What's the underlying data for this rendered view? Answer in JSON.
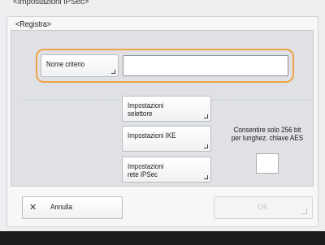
{
  "window": {
    "parent_title": "<Impostazioni IPSec>",
    "dialog_title": "<Registra>"
  },
  "form": {
    "policy_name_label": "Nome criterio",
    "policy_name_value": ""
  },
  "settings": [
    {
      "line1": "Impostazioni",
      "line2": "selettore"
    },
    {
      "line1": "Impostazioni IKE",
      "line2": ""
    },
    {
      "line1": "Impostazioni",
      "line2": "rete IPSec"
    }
  ],
  "aes_option": {
    "line1": "Consentire solo 256 bit",
    "line2": "per lunghez. chiave AES",
    "checked": false
  },
  "footer": {
    "cancel_label": "Annulla",
    "ok_label": "OK",
    "ok_enabled": false
  },
  "colors": {
    "focus_ring": "#f0a24a",
    "bottom_bar": "#1c1c1c"
  }
}
